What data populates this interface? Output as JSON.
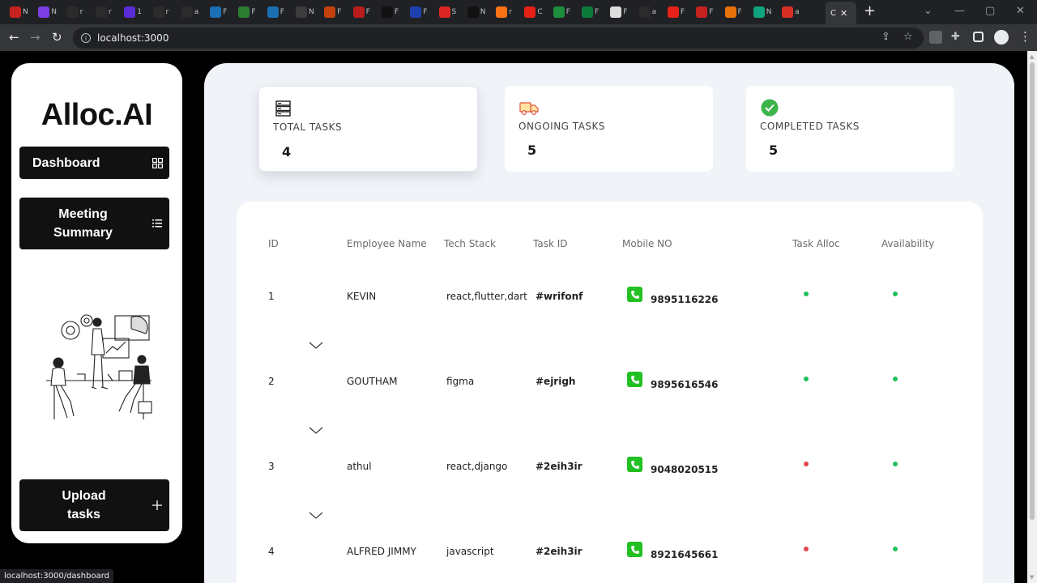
{
  "browser": {
    "active_tab_title": "C",
    "url": "localhost:3000",
    "status_url": "localhost:3000/dashboard",
    "tabs": [
      {
        "icon": "gmail-icon",
        "title": "N",
        "color": "#c5221f"
      },
      {
        "icon": "gmail-icon",
        "title": "N",
        "color": "#7b3fe4"
      },
      {
        "icon": "github-icon",
        "title": "r",
        "color": "#2b2b2b"
      },
      {
        "icon": "github-icon",
        "title": "r",
        "color": "#2b2b2b"
      },
      {
        "icon": "wp-icon",
        "title": "1",
        "color": "#5b2bd6"
      },
      {
        "icon": "github-icon",
        "title": "r",
        "color": "#2b2b2b"
      },
      {
        "icon": "github-icon",
        "title": "a",
        "color": "#2b2b2b"
      },
      {
        "icon": "tailwind-icon",
        "title": "F",
        "color": "#1b6fb3"
      },
      {
        "icon": "site-icon",
        "title": "F",
        "color": "#2e7d32"
      },
      {
        "icon": "tailwind-icon",
        "title": "F",
        "color": "#1b6fb3"
      },
      {
        "icon": "site-icon",
        "title": "N",
        "color": "#3c3c3c"
      },
      {
        "icon": "site-icon",
        "title": "F",
        "color": "#c2410c"
      },
      {
        "icon": "site-icon",
        "title": "F",
        "color": "#b91c1c"
      },
      {
        "icon": "site-icon",
        "title": "F",
        "color": "#111111"
      },
      {
        "icon": "site-icon",
        "title": "F",
        "color": "#1e40af"
      },
      {
        "icon": "site-icon",
        "title": "S",
        "color": "#dc2626"
      },
      {
        "icon": "site-icon",
        "title": "N",
        "color": "#111111"
      },
      {
        "icon": "site-icon",
        "title": "r",
        "color": "#f97316"
      },
      {
        "icon": "youtube-icon",
        "title": "C",
        "color": "#e62117"
      },
      {
        "icon": "site-icon",
        "title": "F",
        "color": "#1e8e3e"
      },
      {
        "icon": "site-icon",
        "title": "F",
        "color": "#0b7a3b"
      },
      {
        "icon": "site-icon",
        "title": "F",
        "color": "#dddddd"
      },
      {
        "icon": "github-icon",
        "title": "a",
        "color": "#2b2b2b"
      },
      {
        "icon": "youtube-icon",
        "title": "F",
        "color": "#e62117"
      },
      {
        "icon": "site-icon",
        "title": "F",
        "color": "#c5221f"
      },
      {
        "icon": "site-icon",
        "title": "F",
        "color": "#e8710a"
      },
      {
        "icon": "site-icon",
        "title": "N",
        "color": "#10a37f"
      },
      {
        "icon": "site-icon",
        "title": "a",
        "color": "#d93025"
      }
    ]
  },
  "sidebar": {
    "logo": "Alloc.AI",
    "dashboard_label": "Dashboard",
    "meeting_label": "Meeting Summary",
    "upload_label": "Upload tasks"
  },
  "stats": [
    {
      "label": "TOTAL TASKS",
      "value": "4"
    },
    {
      "label": "ONGOING TASKS",
      "value": "5"
    },
    {
      "label": "COMPLETED TASKS",
      "value": "5"
    }
  ],
  "table": {
    "headers": [
      "ID",
      "Employee Name",
      "Tech Stack",
      "Task ID",
      "Mobile NO",
      "Task Alloc",
      "Availability"
    ],
    "rows": [
      {
        "id": "1",
        "name": "KEVIN",
        "stack": "react,flutter,dart",
        "task_id": "#wrifonf",
        "mobile": "9895116226",
        "task_alloc": "green",
        "availability": "green"
      },
      {
        "id": "2",
        "name": "GOUTHAM",
        "stack": "figma",
        "task_id": "#ejrigh",
        "mobile": "9895616546",
        "task_alloc": "green",
        "availability": "green"
      },
      {
        "id": "3",
        "name": "athul",
        "stack": "react,django",
        "task_id": "#2eih3ir",
        "mobile": "9048020515",
        "task_alloc": "red",
        "availability": "green"
      },
      {
        "id": "4",
        "name": "ALFRED JIMMY",
        "stack": "javascript",
        "task_id": "#2eih3ir",
        "mobile": "8921645661",
        "task_alloc": "red",
        "availability": "green"
      }
    ]
  },
  "colors": {
    "status_green": "#1fc15a",
    "status_red": "#e0454b",
    "phone_green": "#22c022"
  }
}
